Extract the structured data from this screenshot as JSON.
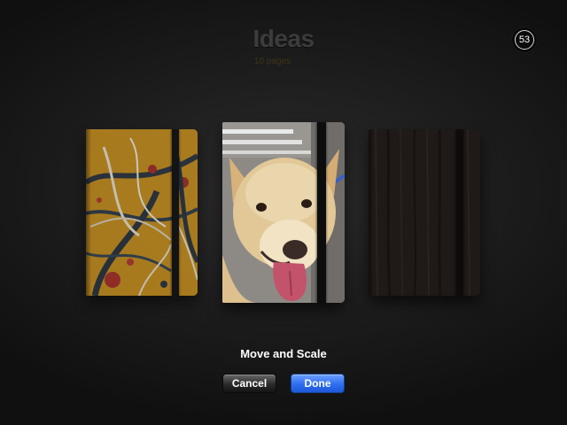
{
  "header": {
    "title": "Ideas",
    "subtitle": "10 pages",
    "badge": "53"
  },
  "notebooks": [
    {
      "cover": "abstract-paint-splatter"
    },
    {
      "cover": "dog-photo",
      "selected": true
    },
    {
      "cover": "dark-wood"
    }
  ],
  "editor": {
    "caption": "Move and Scale",
    "cancel_label": "Cancel",
    "done_label": "Done"
  },
  "colors": {
    "done_button": "#2f6ef0",
    "cancel_button": "#2a2a2a",
    "background": "#1c1c1c"
  }
}
